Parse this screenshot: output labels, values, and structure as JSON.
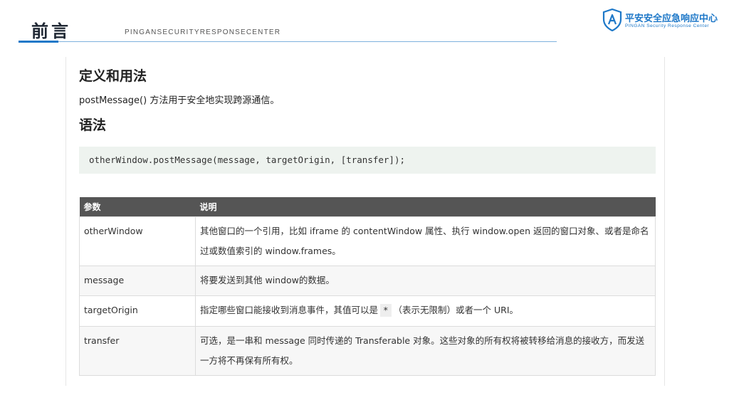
{
  "header": {
    "title": "前言",
    "subtitle": "PINGANSECURITYRESPONSECENTER"
  },
  "logo": {
    "name_cn": "平安安全应急响应中心",
    "name_en": "PINGAN Security Response Center",
    "color": "#1e78c8"
  },
  "section_definition": {
    "heading": "定义和用法",
    "text": "postMessage() 方法用于安全地实现跨源通信。"
  },
  "section_syntax": {
    "heading": "语法",
    "code": "otherWindow.postMessage(message, targetOrigin, [transfer]);"
  },
  "table": {
    "headers": [
      "参数",
      "说明"
    ],
    "rows": [
      {
        "param": "otherWindow",
        "desc": "其他窗口的一个引用，比如 iframe 的 contentWindow 属性、执行 window.open 返回的窗口对象、或者是命名过或数值索引的 window.frames。"
      },
      {
        "param": "message",
        "desc": "将要发送到其他 window的数据。"
      },
      {
        "param": "targetOrigin",
        "desc_before": "指定哪些窗口能接收到消息事件，其值可以是",
        "desc_code": "*",
        "desc_after": "（表示无限制）或者一个 URI。"
      },
      {
        "param": "transfer",
        "desc": "可选，是一串和 message 同时传递的 Transferable 对象。这些对象的所有权将被转移给消息的接收方，而发送一方将不再保有所有权。"
      }
    ]
  }
}
